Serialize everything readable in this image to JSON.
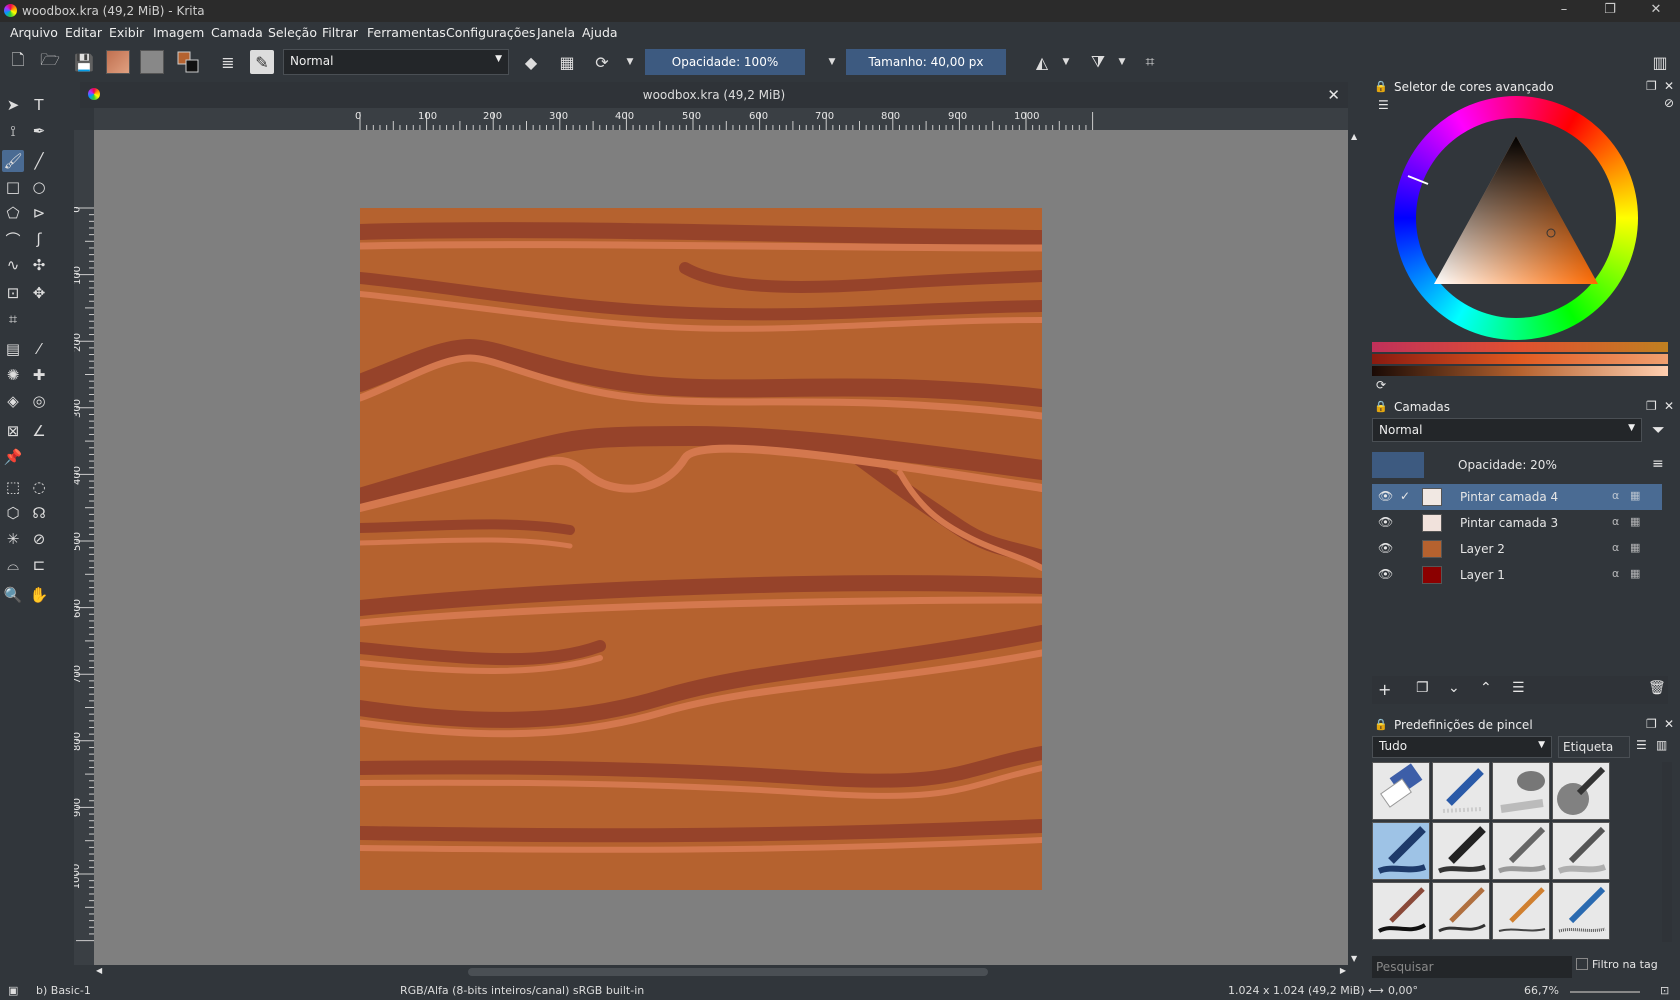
{
  "window": {
    "title": "woodbox.kra (49,2 MiB) - Krita",
    "minimize": "–",
    "maximize": "❐",
    "close": "✕"
  },
  "menu": [
    "Arquivo",
    "Editar",
    "Exibir",
    "Imagem",
    "Camada",
    "Seleção",
    "Filtrar",
    "Ferramentas",
    "Configurações",
    "Janela",
    "Ajuda"
  ],
  "toolbar": {
    "blend_mode": "Normal",
    "opacity": "Opacidade: 100%",
    "size": "Tamanho: 40,00 px"
  },
  "document": {
    "tab_title": "woodbox.kra (49,2 MiB)",
    "close": "✕"
  },
  "ruler": {
    "h_ticks": [
      "0",
      "100",
      "200",
      "300",
      "400",
      "500",
      "600",
      "700",
      "800",
      "900",
      "1000"
    ],
    "v_ticks": [
      "0",
      "100",
      "200",
      "300",
      "400",
      "500",
      "600",
      "700",
      "800",
      "900",
      "1000"
    ]
  },
  "color_selector": {
    "title": "Seletor de cores avançado"
  },
  "layers": {
    "title": "Camadas",
    "blend_mode": "Normal",
    "opacity": "Opacidade:  20%",
    "items": [
      {
        "name": "Pintar camada 4",
        "selected": true,
        "thumb_color": "#f1e8e3",
        "checked": "✓"
      },
      {
        "name": "Pintar camada 3",
        "selected": false,
        "thumb_color": "#f1e2dc"
      },
      {
        "name": "Layer 2",
        "selected": false,
        "thumb_color": "#b5622f"
      },
      {
        "name": "Layer 1",
        "selected": false,
        "thumb_color": "#8b0000"
      }
    ]
  },
  "brushes": {
    "title": "Predefinições de pincel",
    "filter": "Tudo",
    "tag_button": "Etiqueta",
    "search_placeholder": "Pesquisar",
    "tag_filter": "Filtro na tag"
  },
  "status": {
    "preset": "b) Basic-1",
    "color_info": "RGB/Alfa (8-bits inteiros/canal)  sRGB built-in",
    "dimensions": "1.024 x 1.024 (49,2 MiB)",
    "rotation": "0,00°",
    "zoom": "66,7%"
  },
  "colors": {
    "wood_base": "#b5622f",
    "wood_dark": "#96432a",
    "wood_light": "#d4784e",
    "accent": "#3d5a80"
  }
}
